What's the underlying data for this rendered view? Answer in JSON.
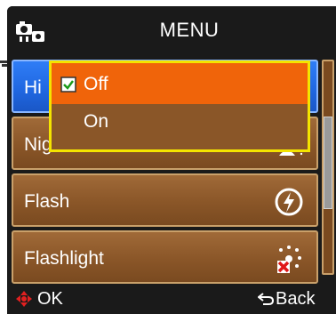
{
  "header": {
    "title": "MENU",
    "icon": "camera-settings-icon"
  },
  "menu": {
    "items": [
      {
        "label": "Hi",
        "icon": ""
      },
      {
        "label": "Night Shot",
        "icon": "night-shot-icon"
      },
      {
        "label": "Flash",
        "icon": "flash-auto-icon"
      },
      {
        "label": "Flashlight",
        "icon": "flashlight-off-icon"
      }
    ]
  },
  "popup": {
    "options": [
      {
        "label": "Off",
        "selected": true
      },
      {
        "label": "On",
        "selected": false
      }
    ]
  },
  "footer": {
    "ok_label": "OK",
    "back_label": "Back"
  },
  "colors": {
    "selected": "#1f66e0",
    "row": "#8a5628",
    "highlight": "#f0640a",
    "popup_border": "#f4e400"
  }
}
